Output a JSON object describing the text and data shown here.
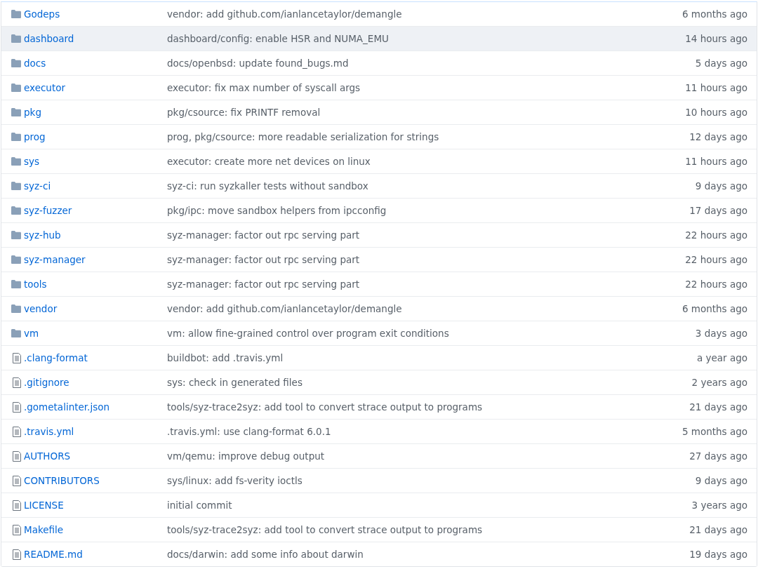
{
  "files": [
    {
      "kind": "folder",
      "name": "Godeps",
      "message": "vendor: add github.com/ianlancetaylor/demangle",
      "age": "6 months ago",
      "highlighted": false
    },
    {
      "kind": "folder",
      "name": "dashboard",
      "message": "dashboard/config: enable HSR and NUMA_EMU",
      "age": "14 hours ago",
      "highlighted": true
    },
    {
      "kind": "folder",
      "name": "docs",
      "message": "docs/openbsd: update found_bugs.md",
      "age": "5 days ago",
      "highlighted": false
    },
    {
      "kind": "folder",
      "name": "executor",
      "message": "executor: fix max number of syscall args",
      "age": "11 hours ago",
      "highlighted": false
    },
    {
      "kind": "folder",
      "name": "pkg",
      "message": "pkg/csource: fix PRINTF removal",
      "age": "10 hours ago",
      "highlighted": false
    },
    {
      "kind": "folder",
      "name": "prog",
      "message": "prog, pkg/csource: more readable serialization for strings",
      "age": "12 days ago",
      "highlighted": false
    },
    {
      "kind": "folder",
      "name": "sys",
      "message": "executor: create more net devices on linux",
      "age": "11 hours ago",
      "highlighted": false
    },
    {
      "kind": "folder",
      "name": "syz-ci",
      "message": "syz-ci: run syzkaller tests without sandbox",
      "age": "9 days ago",
      "highlighted": false
    },
    {
      "kind": "folder",
      "name": "syz-fuzzer",
      "message": "pkg/ipc: move sandbox helpers from ipcconfig",
      "age": "17 days ago",
      "highlighted": false
    },
    {
      "kind": "folder",
      "name": "syz-hub",
      "message": "syz-manager: factor out rpc serving part",
      "age": "22 hours ago",
      "highlighted": false
    },
    {
      "kind": "folder",
      "name": "syz-manager",
      "message": "syz-manager: factor out rpc serving part",
      "age": "22 hours ago",
      "highlighted": false
    },
    {
      "kind": "folder",
      "name": "tools",
      "message": "syz-manager: factor out rpc serving part",
      "age": "22 hours ago",
      "highlighted": false
    },
    {
      "kind": "folder",
      "name": "vendor",
      "message": "vendor: add github.com/ianlancetaylor/demangle",
      "age": "6 months ago",
      "highlighted": false
    },
    {
      "kind": "folder",
      "name": "vm",
      "message": "vm: allow fine-grained control over program exit conditions",
      "age": "3 days ago",
      "highlighted": false
    },
    {
      "kind": "file",
      "name": ".clang-format",
      "message": "buildbot: add .travis.yml",
      "age": "a year ago",
      "highlighted": false
    },
    {
      "kind": "file",
      "name": ".gitignore",
      "message": "sys: check in generated files",
      "age": "2 years ago",
      "highlighted": false
    },
    {
      "kind": "file",
      "name": ".gometalinter.json",
      "message": "tools/syz-trace2syz: add tool to convert strace output to programs",
      "age": "21 days ago",
      "highlighted": false
    },
    {
      "kind": "file",
      "name": ".travis.yml",
      "message": ".travis.yml: use clang-format 6.0.1",
      "age": "5 months ago",
      "highlighted": false
    },
    {
      "kind": "file",
      "name": "AUTHORS",
      "message": "vm/qemu: improve debug output",
      "age": "27 days ago",
      "highlighted": false
    },
    {
      "kind": "file",
      "name": "CONTRIBUTORS",
      "message": "sys/linux: add fs-verity ioctls",
      "age": "9 days ago",
      "highlighted": false
    },
    {
      "kind": "file",
      "name": "LICENSE",
      "message": "initial commit",
      "age": "3 years ago",
      "highlighted": false
    },
    {
      "kind": "file",
      "name": "Makefile",
      "message": "tools/syz-trace2syz: add tool to convert strace output to programs",
      "age": "21 days ago",
      "highlighted": false
    },
    {
      "kind": "file",
      "name": "README.md",
      "message": "docs/darwin: add some info about darwin",
      "age": "19 days ago",
      "highlighted": false
    }
  ]
}
